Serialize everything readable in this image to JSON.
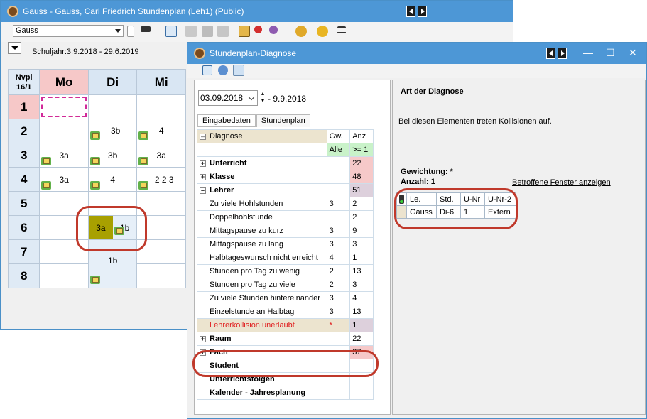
{
  "main_window": {
    "title": "Gauss - Gauss, Carl Friedrich  Stundenplan  (Leh1) (Public)",
    "teacher_select": "Gauss",
    "schuljahr": "Schuljahr:3.9.2018 - 29.6.2019",
    "corner_label": "Nvpl\n16/1",
    "days": [
      "Mo",
      "Di",
      "Mi"
    ],
    "periods": [
      "1",
      "2",
      "3",
      "4",
      "5",
      "6",
      "7",
      "8"
    ],
    "lessons": {
      "di_2": "3b",
      "mi_2": "4",
      "mo_3": "3a",
      "di_3": "3b",
      "mi_3": "3a",
      "mo_4": "3a",
      "di_4": "4",
      "mi_4": "2 2 3",
      "di_6a": "3a",
      "di_6b": "1b",
      "di_7": "1b"
    }
  },
  "diag_window": {
    "title": "Stundenplan-Diagnose",
    "date_from": "03.09.2018",
    "date_to": "- 9.9.2018",
    "tabs": [
      "Eingabedaten",
      "Stundenplan"
    ],
    "headers": {
      "diagnose": "Diagnose",
      "gw": "Gw.",
      "anz": "Anz"
    },
    "filter": {
      "gw": "Alle",
      "anz": ">= 1"
    },
    "rows": [
      {
        "name": "Unterricht",
        "gw": "",
        "anz": "22"
      },
      {
        "name": "Klasse",
        "gw": "",
        "anz": "48"
      },
      {
        "name": "Lehrer",
        "gw": "",
        "anz": "51"
      },
      {
        "name": "Zu viele Hohlstunden",
        "gw": "3",
        "anz": "2"
      },
      {
        "name": "Doppelhohlstunde",
        "gw": "",
        "anz": "2"
      },
      {
        "name": "Mittagspause zu kurz",
        "gw": "3",
        "anz": "9"
      },
      {
        "name": "Mittagspause zu lang",
        "gw": "3",
        "anz": "3"
      },
      {
        "name": "Halbtageswunsch nicht erreicht",
        "gw": "4",
        "anz": "1"
      },
      {
        "name": "Stunden pro Tag zu wenig",
        "gw": "2",
        "anz": "13"
      },
      {
        "name": "Stunden pro Tag zu viele",
        "gw": "2",
        "anz": "3"
      },
      {
        "name": "Zu viele Stunden hintereinander",
        "gw": "3",
        "anz": "4"
      },
      {
        "name": "Einzelstunde an Halbtag",
        "gw": "3",
        "anz": "13"
      },
      {
        "name": "Lehrerkollision unerlaubt",
        "gw": "*",
        "anz": "1"
      },
      {
        "name": "Raum",
        "gw": "",
        "anz": "22"
      },
      {
        "name": "Fach",
        "gw": "",
        "anz": "37"
      },
      {
        "name": "Student",
        "gw": "",
        "anz": ""
      },
      {
        "name": "Unterrichtsfolgen",
        "gw": "",
        "anz": ""
      },
      {
        "name": "Kalender - Jahresplanung",
        "gw": "",
        "anz": ""
      }
    ],
    "right": {
      "heading": "Art der Diagnose",
      "description": "Bei diesen Elementen treten Kollisionen auf.",
      "gewichtung": "Gewichtung: *",
      "anzahl": "Anzahl: 1",
      "link": "Betroffene Fenster anzeigen",
      "table_headers": [
        "Le.",
        "Std.",
        "U-Nr",
        "U-Nr-2"
      ],
      "table_row": [
        "Gauss",
        "Di-6",
        "1",
        "Extern"
      ]
    }
  },
  "colors": {
    "titlebar": "#4d97d6",
    "highlight_red": "#c0392b",
    "lesson_olive": "#a8a000",
    "monday_pink": "#f6c8c8"
  }
}
